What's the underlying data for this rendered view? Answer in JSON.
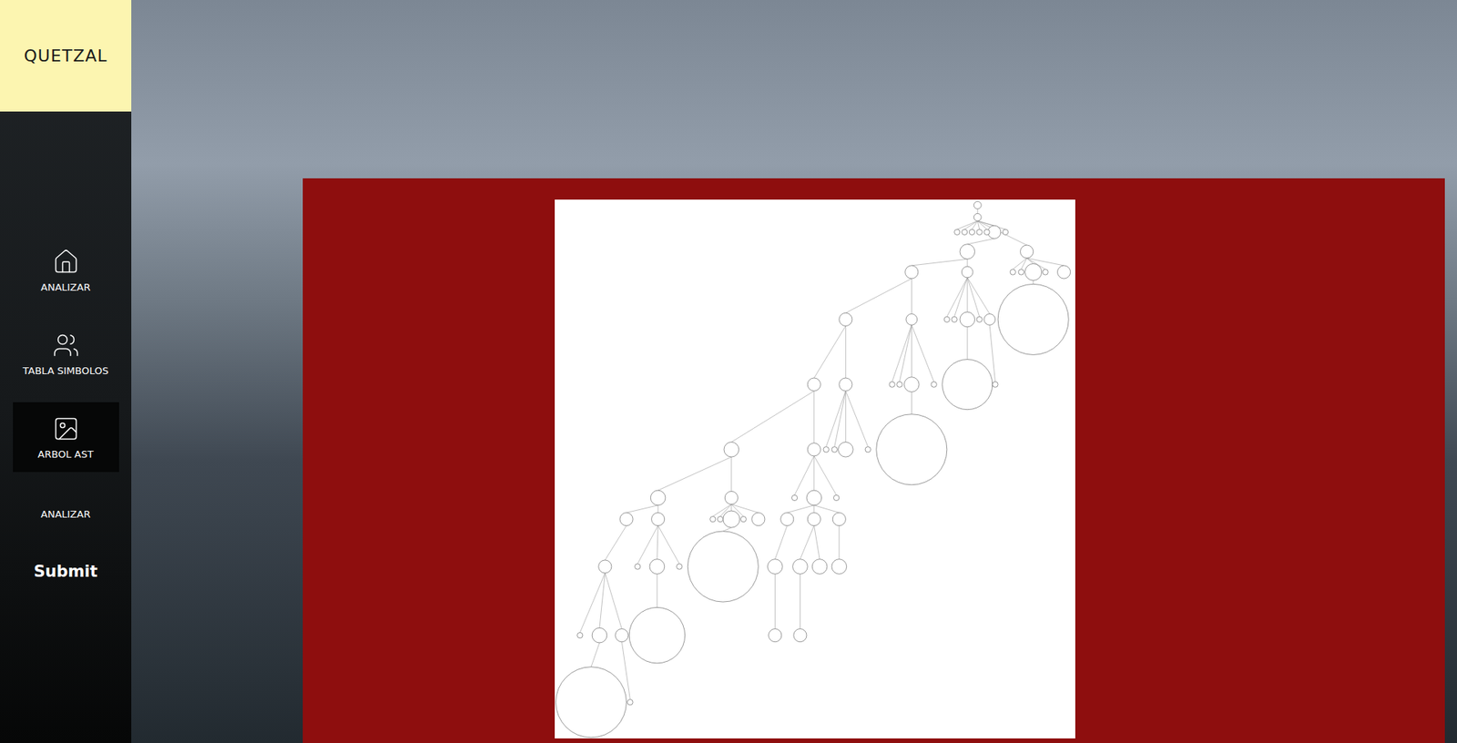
{
  "sidebar": {
    "logo": "QUETZAL",
    "items": [
      {
        "label": "ANALIZAR",
        "selected": false
      },
      {
        "label": "TABLA SIMBOLOS",
        "selected": false
      },
      {
        "label": "ARBOL AST",
        "selected": true
      }
    ],
    "actions": [
      {
        "label": "ANALIZAR",
        "kind": "link"
      },
      {
        "label": "Submit",
        "kind": "button"
      }
    ]
  },
  "panel": {
    "content": "ast-tree-image"
  }
}
